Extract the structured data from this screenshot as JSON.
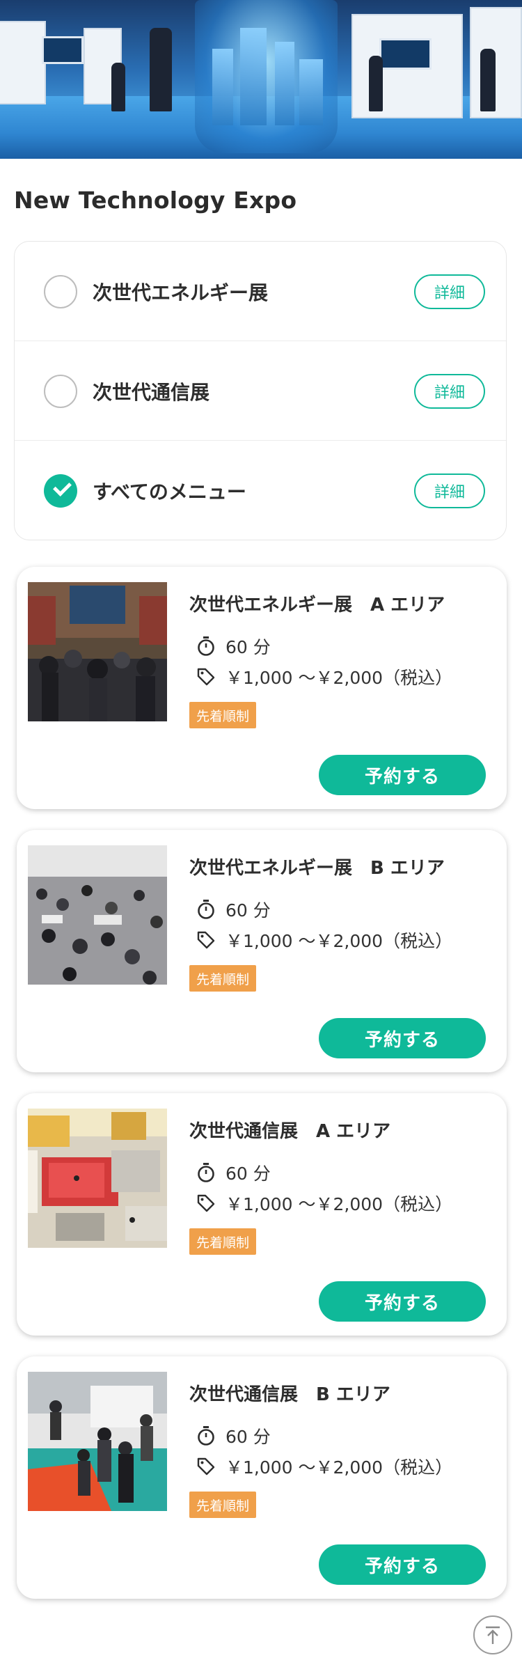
{
  "page": {
    "title": "New Technology Expo"
  },
  "filters": [
    {
      "label": "次世代エネルギー展",
      "checked": false,
      "detail_label": "詳細"
    },
    {
      "label": "次世代通信展",
      "checked": false,
      "detail_label": "詳細"
    },
    {
      "label": "すべてのメニュー",
      "checked": true,
      "detail_label": "詳細"
    }
  ],
  "events": [
    {
      "title": "次世代エネルギー展　A エリア",
      "duration": "60 分",
      "price": "￥1,000 〜￥2,000（税込）",
      "badge": "先着順制",
      "button": "予約する"
    },
    {
      "title": "次世代エネルギー展　B エリア",
      "duration": "60 分",
      "price": "￥1,000 〜￥2,000（税込）",
      "badge": "先着順制",
      "button": "予約する"
    },
    {
      "title": "次世代通信展　A エリア",
      "duration": "60 分",
      "price": "￥1,000 〜￥2,000（税込）",
      "badge": "先着順制",
      "button": "予約する"
    },
    {
      "title": "次世代通信展　B エリア",
      "duration": "60 分",
      "price": "￥1,000 〜￥2,000（税込）",
      "badge": "先着順制",
      "button": "予約する"
    }
  ],
  "colors": {
    "accent": "#0fb999",
    "badge": "#f0a04a"
  },
  "icons": {
    "duration": "timer-icon",
    "price": "tag-icon",
    "scroll_top": "arrow-up-icon"
  }
}
